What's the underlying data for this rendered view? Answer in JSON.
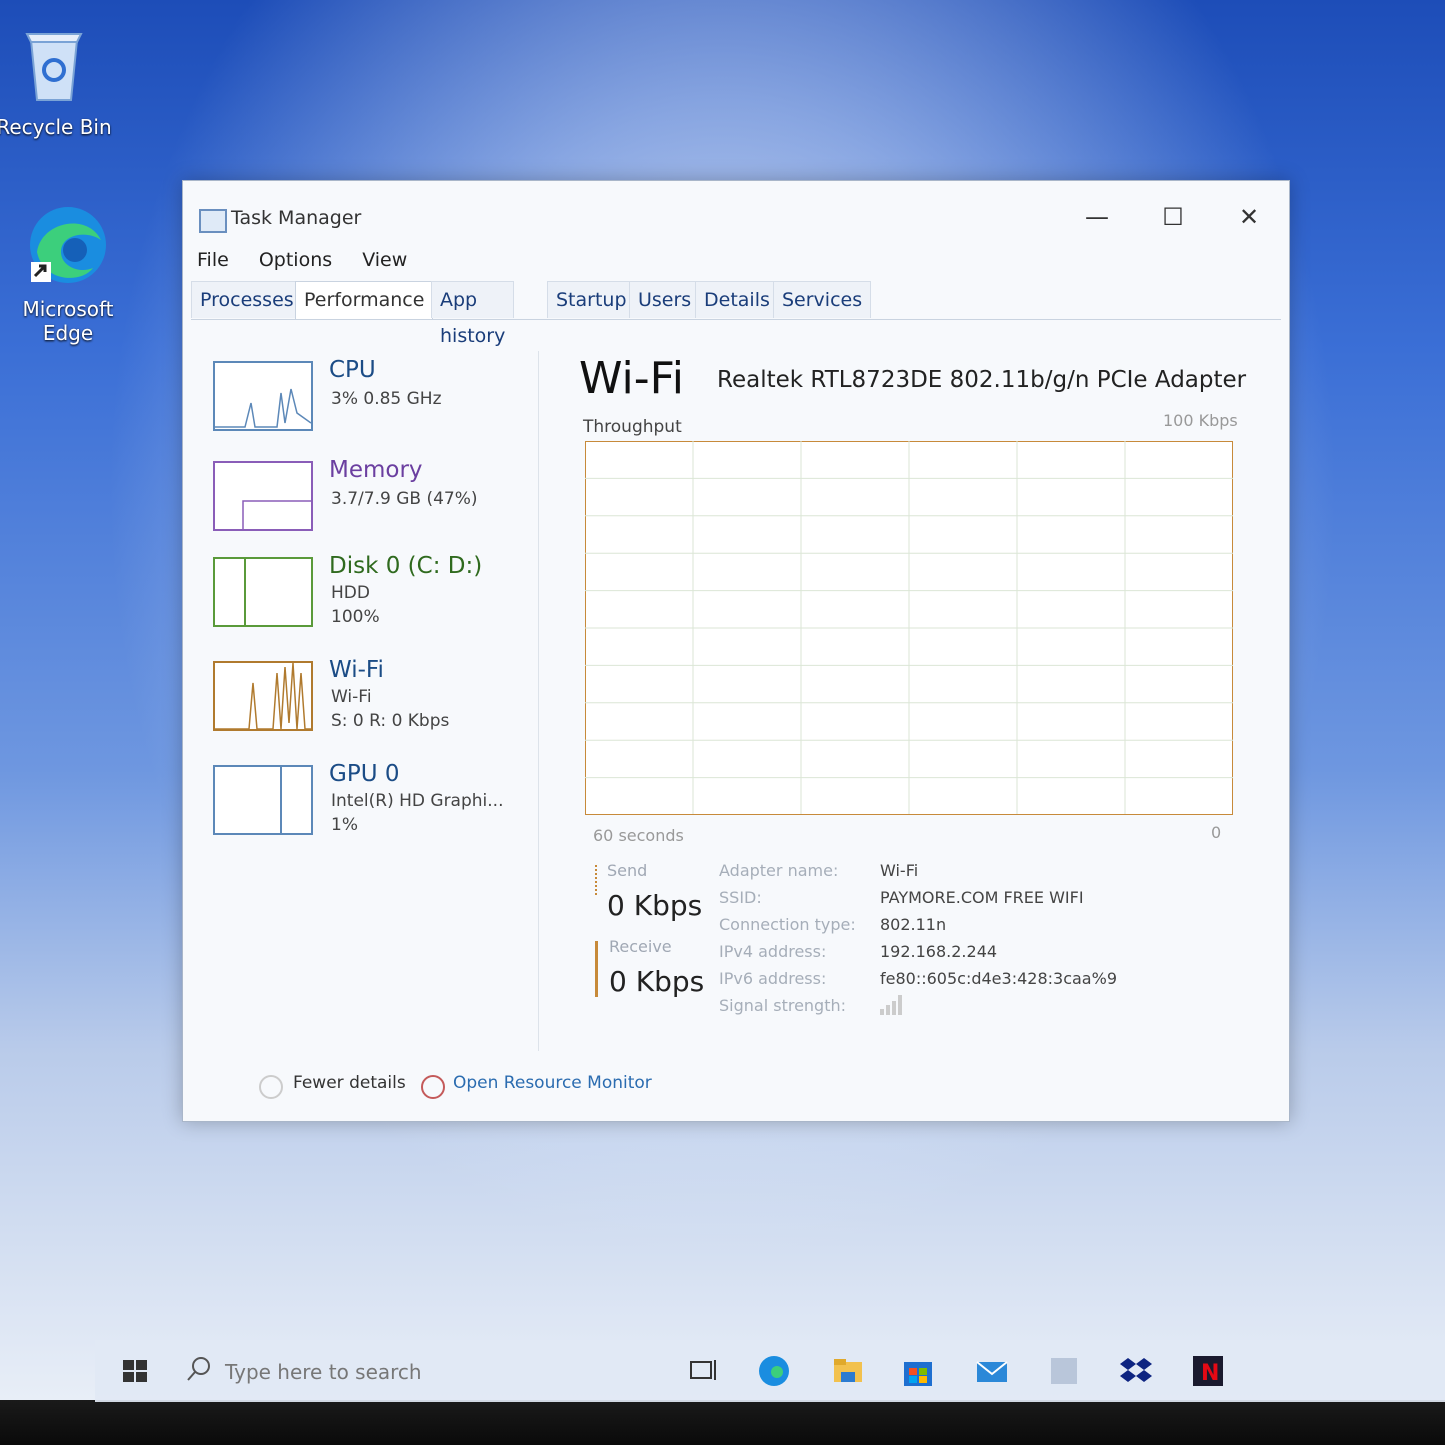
{
  "desktop": {
    "icons": [
      {
        "label": "Recycle Bin"
      },
      {
        "label": "Microsoft Edge"
      }
    ]
  },
  "window": {
    "title": "Task Manager",
    "controls": {
      "minimize": "—",
      "maximize": "☐",
      "close": "✕"
    },
    "menu": [
      "File",
      "Options",
      "View"
    ],
    "tabs": [
      "Processes",
      "Performance",
      "App history",
      "Startup",
      "Users",
      "Details",
      "Services"
    ],
    "active_tab": "Performance"
  },
  "sidebar": {
    "cpu": {
      "title": "CPU",
      "line1": "3% 0.85 GHz"
    },
    "memory": {
      "title": "Memory",
      "line1": "3.7/7.9 GB (47%)"
    },
    "disk": {
      "title": "Disk 0 (C: D:)",
      "line1": "HDD",
      "line2": "100%"
    },
    "wifi": {
      "title": "Wi-Fi",
      "line1": "Wi-Fi",
      "line2": "S: 0 R: 0 Kbps"
    },
    "gpu": {
      "title": "GPU 0",
      "line1": "Intel(R) HD Graphi...",
      "line2": "1%"
    }
  },
  "main": {
    "title": "Wi-Fi",
    "adapter": "Realtek RTL8723DE 802.11b/g/n PCIe Adapter",
    "graph_label": "Throughput",
    "scale_max": "100 Kbps",
    "time_span": "60 seconds",
    "scale_min": "0",
    "send_label": "Send",
    "send_value": "0 Kbps",
    "receive_label": "Receive",
    "receive_value": "0 Kbps",
    "info": [
      {
        "key": "Adapter name:",
        "value": "Wi-Fi"
      },
      {
        "key": "SSID:",
        "value": "PAYMORE.COM FREE WIFI"
      },
      {
        "key": "Connection type:",
        "value": "802.11n"
      },
      {
        "key": "IPv4 address:",
        "value": "192.168.2.244"
      },
      {
        "key": "IPv6 address:",
        "value": "fe80::605c:d4e3:428:3caa%9"
      },
      {
        "key": "Signal strength:",
        "value": ""
      }
    ],
    "colors": {
      "send_line": "#c78a3a",
      "receive_line": "#c78a3a",
      "grid": "#dbe6d6"
    }
  },
  "footer": {
    "fewer_details": "Fewer details",
    "resource_monitor": "Open Resource Monitor"
  },
  "taskbar": {
    "search_placeholder": "Type here to search",
    "icons": [
      "windows-start-icon",
      "search-icon",
      "task-view-icon",
      "edge-icon",
      "file-explorer-icon",
      "store-icon",
      "mail-icon",
      "app-icon",
      "dropbox-icon",
      "netflix-icon"
    ]
  },
  "chart_data": {
    "type": "line",
    "title": "Throughput",
    "xlabel": "60 seconds",
    "ylabel": "",
    "ylim": [
      0,
      100
    ],
    "x": [
      0,
      5,
      10,
      15,
      20,
      25,
      30,
      32,
      34,
      36,
      38,
      40,
      42,
      44,
      46,
      48,
      50,
      52,
      54,
      56,
      58,
      60
    ],
    "series": [
      {
        "name": "Receive",
        "values": [
          0,
          0,
          0,
          0,
          0,
          0,
          0,
          0,
          0,
          0,
          0,
          0,
          0,
          0,
          0,
          0,
          0,
          0,
          0,
          0,
          0,
          0
        ]
      }
    ]
  }
}
